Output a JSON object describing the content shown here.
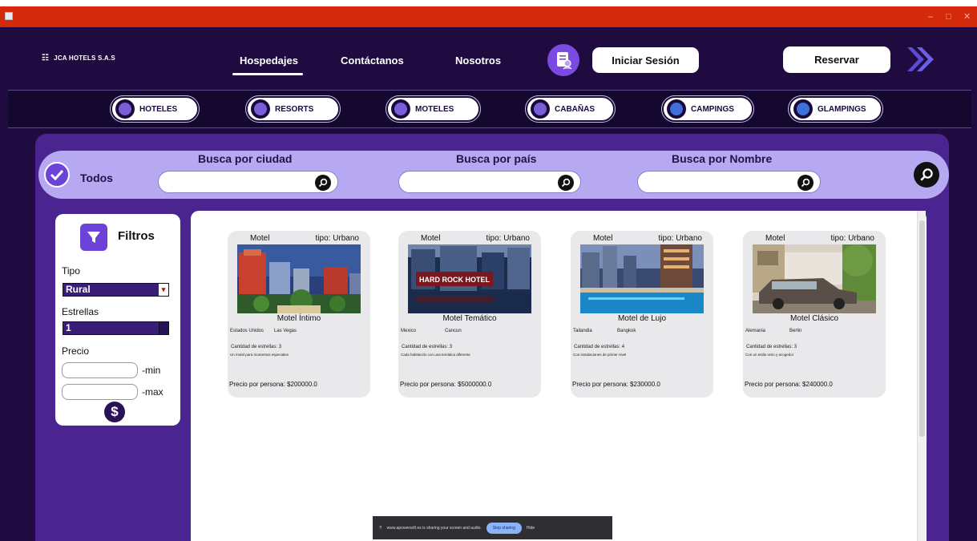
{
  "window": {
    "controls": [
      "–",
      "□",
      "✕"
    ]
  },
  "header": {
    "logo_text": "JCA HOTELS S.A.S",
    "nav": {
      "hospedajes": "Hospedajes",
      "contactanos": "Contáctanos",
      "nosotros": "Nosotros"
    },
    "login_label": "Iniciar Sesión",
    "reserve_label": "Reservar"
  },
  "categories": [
    "HOTELES",
    "RESORTS",
    "MOTELES",
    "CABAÑAS",
    "CAMPINGS",
    "GLAMPINGS"
  ],
  "search": {
    "all_label": "Todos",
    "by_city_label": "Busca por ciudad",
    "by_country_label": "Busca por país",
    "by_name_label": "Busca por Nombre",
    "city_value": "",
    "country_value": "",
    "name_value": ""
  },
  "filters": {
    "title": "Filtros",
    "type_label": "Tipo",
    "type_value": "Rural",
    "stars_label": "Estrellas",
    "stars_value": "1",
    "price_label": "Precio",
    "min_suffix": "-min",
    "max_suffix": "-max",
    "min_value": "",
    "max_value": ""
  },
  "results": [
    {
      "type": "Motel",
      "kind": "tipo: Urbano",
      "name": "Motel Íntimo",
      "country": "Estados Unidos",
      "city": "Las Vegas",
      "stars": "Cantidad de estrellas: 3",
      "description": "Un motel para momentos especiales",
      "price": "Precio por persona: $200000.0"
    },
    {
      "type": "Motel",
      "kind": "tipo: Urbano",
      "name": "Motel Temático",
      "country": "Mexico",
      "city": "Cancun",
      "stars": "Cantidad de estrellas: 3",
      "description": "Cada habitación con una temática diferente",
      "price": "Precio por persona: $5000000.0",
      "photo_sign": "HARD ROCK HOTEL"
    },
    {
      "type": "Motel",
      "kind": "tipo: Urbano",
      "name": "Motel de Lujo",
      "country": "Tailandia",
      "city": "Bangkok",
      "stars": "Cantidad de estrellas: 4",
      "description": "Con instalaciones de primer nivel",
      "price": "Precio por persona: $230000.0"
    },
    {
      "type": "Motel",
      "kind": "tipo: Urbano",
      "name": "Motel Clásico",
      "country": "Alemania",
      "city": "Berlin",
      "stars": "Cantidad de estrellas: 3",
      "description": "Con un estilo retro y acogedor",
      "price": "Precio por persona: $240000.0"
    }
  ],
  "share_bar": {
    "message": "www.apowersoft.es is sharing your screen and audio.",
    "stop_label": "Stop sharing",
    "hide_label": "Hide"
  },
  "colors": {
    "titlebar": "#d42a0c",
    "app_background": "#1f0b40",
    "panel": "#4a2590",
    "search_bar": "#b6a9f1",
    "accent": "#6b43d9"
  }
}
